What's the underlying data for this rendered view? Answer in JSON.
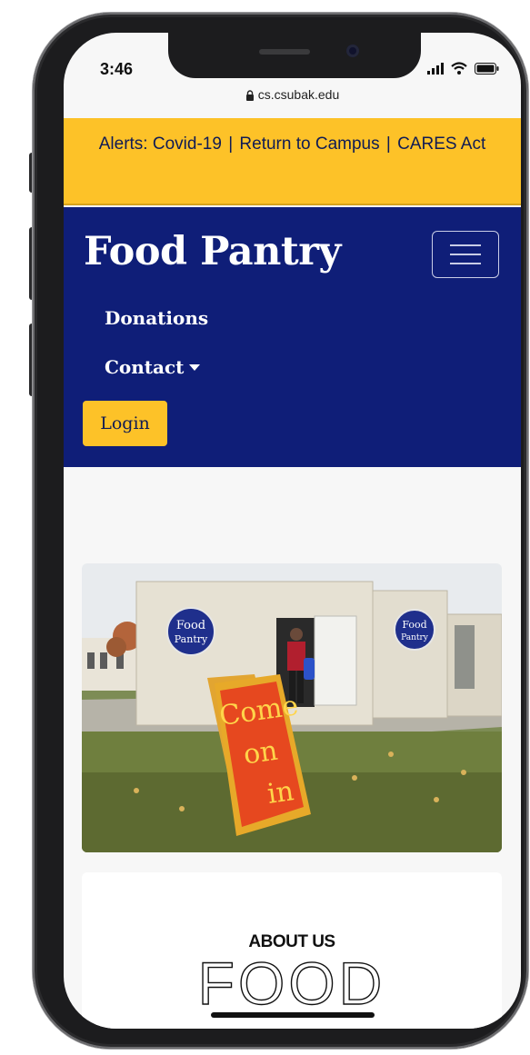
{
  "status": {
    "time": "3:46"
  },
  "browser": {
    "url": "cs.csubak.edu"
  },
  "alert": {
    "prefix": "Alerts:",
    "links": [
      "Covid-19",
      "Return to Campus",
      "CARES Act"
    ],
    "separator": "|"
  },
  "navbar": {
    "brand": "Food Pantry",
    "links": [
      "Donations",
      "Contact"
    ],
    "login": "Login"
  },
  "photo": {
    "sign_text": [
      "Come",
      "on",
      "in"
    ],
    "logo_text": [
      "Food",
      "Pantry"
    ]
  },
  "about": {
    "heading": "ABOUT US",
    "big_word": "FOOD"
  },
  "colors": {
    "alert_bg": "#fdc228",
    "navbar_bg": "#0f1e78",
    "brand_text": "#ffffff",
    "alert_text": "#0f1b55"
  }
}
